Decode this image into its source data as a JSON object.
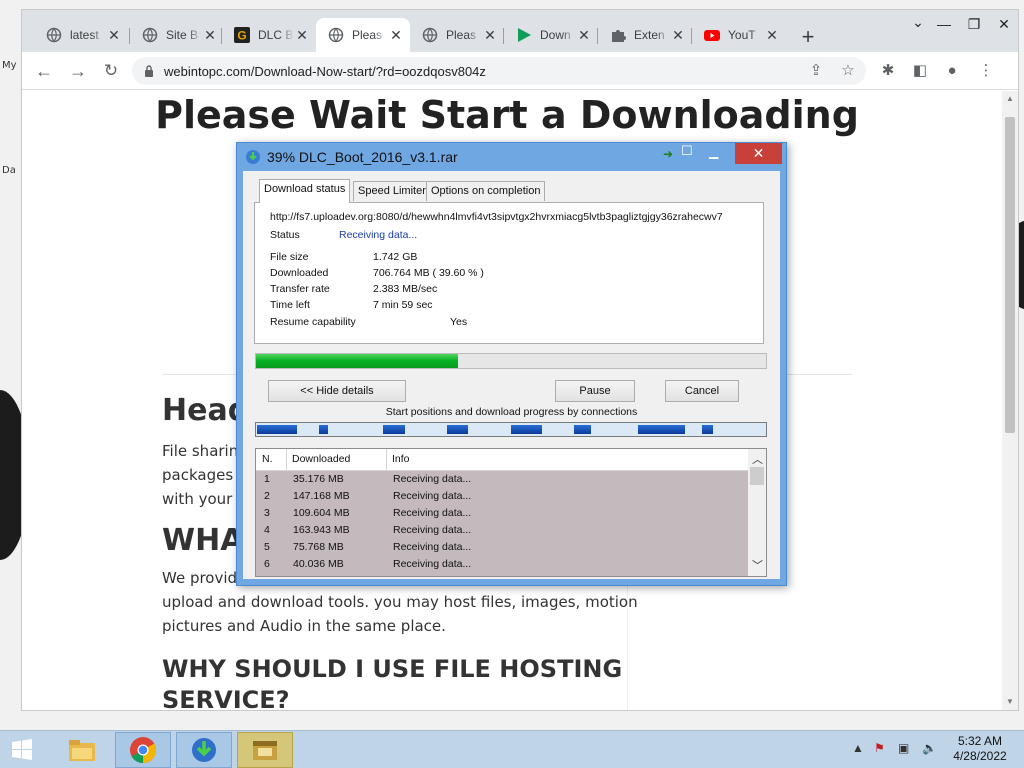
{
  "browser": {
    "tabs": [
      {
        "title": "latest",
        "icon": "globe-icon"
      },
      {
        "title": "Site B",
        "icon": "globe-icon"
      },
      {
        "title": "DLC B",
        "icon": "g-logo-icon"
      },
      {
        "title": "Pleas",
        "icon": "globe-icon",
        "active": true
      },
      {
        "title": "Pleas",
        "icon": "globe-icon"
      },
      {
        "title": "Down",
        "icon": "play-icon"
      },
      {
        "title": "Exten",
        "icon": "puzzle-icon"
      },
      {
        "title": "YouT",
        "icon": "youtube-icon"
      }
    ],
    "url": "webintopc.com/Download-Now-start/?rd=oozdqosv804z"
  },
  "page": {
    "title": "Please Wait Start a Downloading",
    "heading_fragment": "Head",
    "paragraph1_lines": [
      "File sharing",
      "packages t",
      "with your C"
    ],
    "what_fragment": "WHA",
    "paragraph2_lines": [
      "We provide",
      "upload and download tools. you may host files, images, motion",
      "pictures and Audio in the same place."
    ],
    "why_heading_lines": [
      "WHY SHOULD I USE FILE HOSTING",
      "SERVICE?"
    ]
  },
  "idm": {
    "title": "39% DLC_Boot_2016_v3.1.rar",
    "tabs": [
      "Download status",
      "Speed Limiter",
      "Options on completion"
    ],
    "url": "http://fs7.uploadev.org:8080/d/hewwhn4lmvfi4vt3sipvtgx2hvrxmiacg5lvtb3pagliztgjgy36zrahecwv7",
    "status_label": "Status",
    "status_value": "Receiving data...",
    "fields": [
      {
        "label": "File size",
        "value": "1.742  GB"
      },
      {
        "label": "Downloaded",
        "value": "706.764  MB  ( 39.60 % )"
      },
      {
        "label": "Transfer rate",
        "value": "2.383  MB/sec"
      },
      {
        "label": "Time left",
        "value": "7 min 59 sec"
      },
      {
        "label": "Resume capability",
        "value": "Yes"
      }
    ],
    "progress": 0.396,
    "buttons": {
      "hide_details": "<< Hide details",
      "pause": "Pause",
      "cancel": "Cancel"
    },
    "connections_label": "Start positions and download progress by connections",
    "grid_headers": [
      "N.",
      "Downloaded",
      "Info"
    ],
    "connections": [
      {
        "n": "1",
        "downloaded": "35.176  MB",
        "info": "Receiving data..."
      },
      {
        "n": "2",
        "downloaded": "147.168  MB",
        "info": "Receiving data..."
      },
      {
        "n": "3",
        "downloaded": "109.604  MB",
        "info": "Receiving data..."
      },
      {
        "n": "4",
        "downloaded": "163.943  MB",
        "info": "Receiving data..."
      },
      {
        "n": "5",
        "downloaded": "75.768  MB",
        "info": "Receiving data..."
      },
      {
        "n": "6",
        "downloaded": "40.036  MB",
        "info": "Receiving data..."
      }
    ]
  },
  "desktop": {
    "fragments": [
      "My",
      "Da"
    ]
  },
  "taskbar": {
    "apps": [
      "file-explorer-icon",
      "chrome-icon",
      "idm-icon",
      "archive-icon"
    ],
    "time": "5:32 AM",
    "date": "4/28/2022"
  }
}
